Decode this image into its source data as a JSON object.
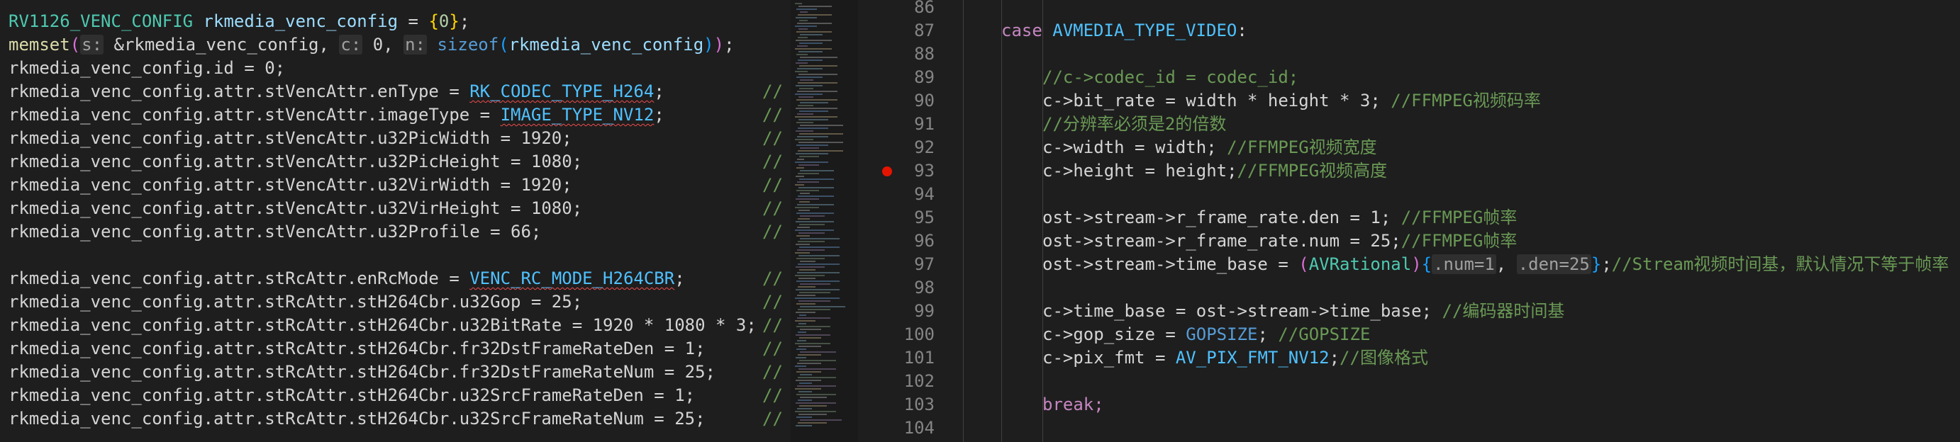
{
  "left_editor": {
    "lines": [
      {
        "type": "RV1126_VENC_CONFIG",
        "var": "rkmedia_venc_config",
        "eq": " = ",
        "brace_open": "{",
        "num": "0",
        "brace_close": "}",
        "end": ";"
      },
      {
        "fn": "memset",
        "p_open": "(",
        "hint_s": "s:",
        "arg1": " &rkmedia_venc_config, ",
        "hint_c": "c:",
        "arg2": " 0, ",
        "hint_n": "n:",
        "kw": " sizeof",
        "p2_open": "(",
        "arg3": "rkmedia_venc_config",
        "p2_close": ")",
        "p_close": ")",
        "end": ";"
      },
      {
        "text": "rkmedia_venc_config.id = 0;"
      },
      {
        "pre": "rkmedia_venc_config.attr.stVencAttr.enType = ",
        "enum": "RK_CODEC_TYPE_H264",
        "post": ";"
      },
      {
        "pre": "rkmedia_venc_config.attr.stVencAttr.imageType = ",
        "enum": "IMAGE_TYPE_NV12",
        "post": ";"
      },
      {
        "text": "rkmedia_venc_config.attr.stVencAttr.u32PicWidth = 1920;"
      },
      {
        "text": "rkmedia_venc_config.attr.stVencAttr.u32PicHeight = 1080;"
      },
      {
        "text": "rkmedia_venc_config.attr.stVencAttr.u32VirWidth = 1920;"
      },
      {
        "text": "rkmedia_venc_config.attr.stVencAttr.u32VirHeight = 1080;"
      },
      {
        "text": "rkmedia_venc_config.attr.stVencAttr.u32Profile = 66;"
      },
      {
        "text": ""
      },
      {
        "pre": "rkmedia_venc_config.attr.stRcAttr.enRcMode = ",
        "enum": "VENC_RC_MODE_H264CBR",
        "post": ";"
      },
      {
        "text": "rkmedia_venc_config.attr.stRcAttr.stH264Cbr.u32Gop = 25;"
      },
      {
        "text": "rkmedia_venc_config.attr.stRcAttr.stH264Cbr.u32BitRate = 1920 * 1080 * 3;"
      },
      {
        "text": "rkmedia_venc_config.attr.stRcAttr.stH264Cbr.fr32DstFrameRateDen = 1;"
      },
      {
        "text": "rkmedia_venc_config.attr.stRcAttr.stH264Cbr.fr32DstFrameRateNum = 25;"
      },
      {
        "text": "rkmedia_venc_config.attr.stRcAttr.stH264Cbr.u32SrcFrameRateDen = 1;"
      },
      {
        "text": "rkmedia_venc_config.attr.stRcAttr.stH264Cbr.u32SrcFrameRateNum = 25;"
      }
    ],
    "trailing_comment": "//"
  },
  "right_editor": {
    "line_numbers": [
      "86",
      "87",
      "88",
      "89",
      "90",
      "91",
      "92",
      "93",
      "94",
      "95",
      "96",
      "97",
      "98",
      "99",
      "100",
      "101",
      "102",
      "103",
      "104"
    ],
    "breakpoint_line": "93",
    "line87": {
      "kw": "case",
      "name": "AVMEDIA_TYPE_VIDEO",
      "colon": ":"
    },
    "line89": "//c->codec_id = codec_id;",
    "line90": {
      "code": "c->bit_rate = width * height * 3; ",
      "comment": "//FFMPEG视频码率"
    },
    "line91": "//分辨率必须是2的倍数",
    "line92": {
      "code": "c->width = width; ",
      "comment": "//FFMPEG视频宽度"
    },
    "line93": {
      "code": "c->height = height;",
      "comment": "//FFMPEG视频高度"
    },
    "line95": {
      "code": "ost->stream->r_frame_rate.den = 1; ",
      "comment": "//FFMPEG帧率"
    },
    "line96": {
      "code": "ost->stream->r_frame_rate.num = 25;",
      "comment": "//FFMPEG帧率"
    },
    "line97": {
      "pre": "ost->stream->time_base = ",
      "p_open": "(",
      "type": "AVRational",
      "p_close": ")",
      "b_open": "{",
      "f1": ".num=1",
      "sep": ", ",
      "f2": ".den=25",
      "b_close": "}",
      "end": ";",
      "comment": "//Stream视频时间基，默认情况下等于帧率"
    },
    "line99": {
      "code": "c->time_base = ost->stream->time_base; ",
      "comment": "//编码器时间基"
    },
    "line100": {
      "pre": "c->gop_size = ",
      "macro": "GOPSIZE",
      "post": "; ",
      "comment": "//GOPSIZE"
    },
    "line101": {
      "pre": "c->pix_fmt = ",
      "enum": "AV_PIX_FMT_NV12",
      "post": ";",
      "comment": "//图像格式"
    },
    "line103": "break;"
  }
}
